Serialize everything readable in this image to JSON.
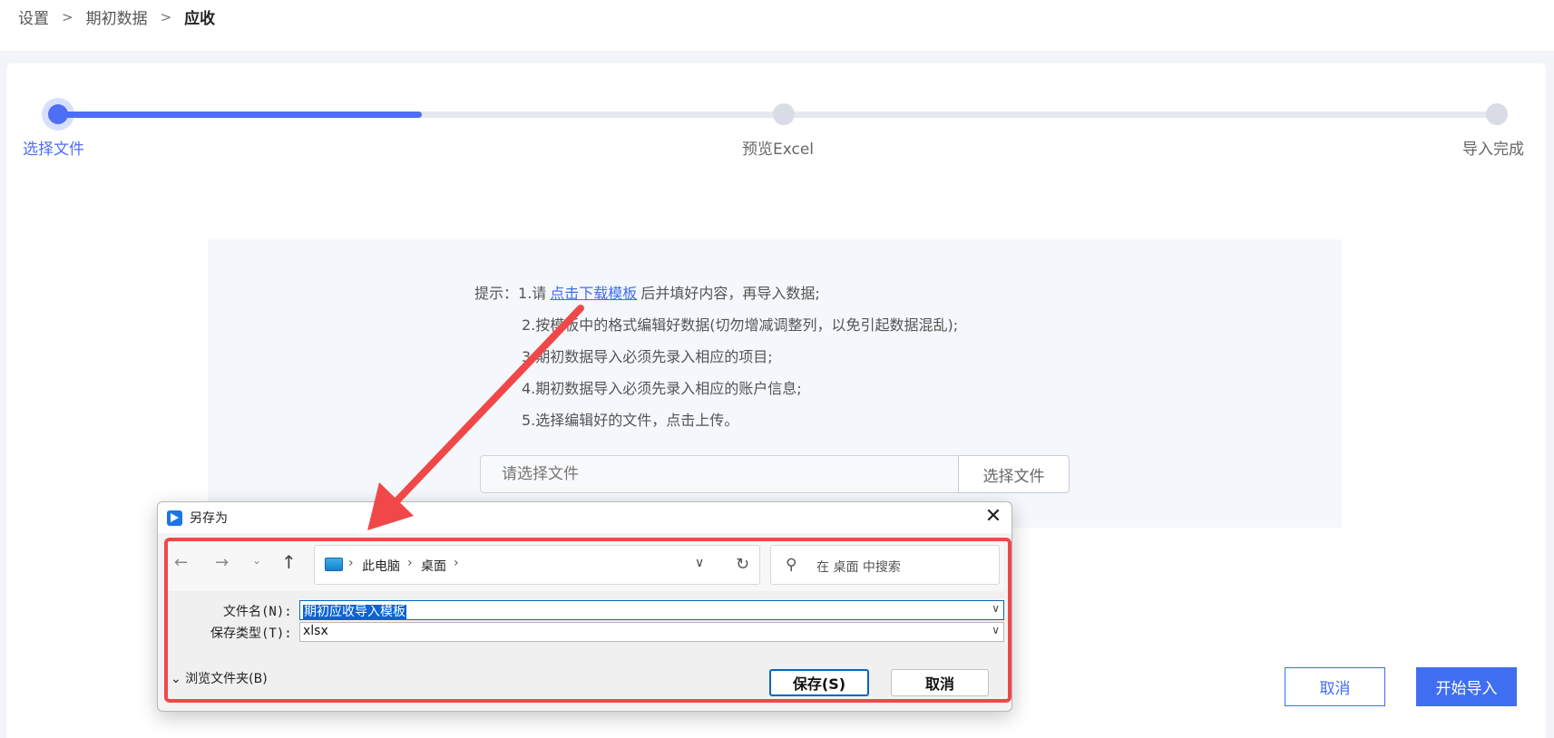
{
  "breadcrumb": {
    "item1": "设置",
    "item2": "期初数据",
    "current": "应收",
    "sep": ">"
  },
  "steps": [
    {
      "label": "选择文件"
    },
    {
      "label": "预览Excel"
    },
    {
      "label": "导入完成"
    }
  ],
  "tips": {
    "prefix": "提示：",
    "line1_before": "1.请",
    "download_link": "点击下载模板",
    "line1_after": "后并填好内容，再导入数据;",
    "line2": "2.按模板中的格式编辑好数据(切勿增减调整列，以免引起数据混乱);",
    "line3": "3.期初数据导入必须先录入相应的项目;",
    "line4": "4.期初数据导入必须先录入相应的账户信息;",
    "line5": "5.选择编辑好的文件，点击上传。"
  },
  "file_picker": {
    "placeholder": "请选择文件",
    "button": "选择文件"
  },
  "footer": {
    "cancel": "取消",
    "import": "开始导入"
  },
  "dialog": {
    "title": "另存为",
    "path": [
      "此电脑",
      "桌面"
    ],
    "search_placeholder": "在 桌面 中搜索",
    "filename_label": "文件名(N):",
    "filename_value": "期初应收导入模板",
    "type_label": "保存类型(T):",
    "type_value": "xlsx",
    "browse_folders": "浏览文件夹(B)",
    "save": "保存(S)",
    "cancel": "取消"
  },
  "colors": {
    "accent": "#3f6ef0",
    "annotation": "#f04848",
    "dialog_blue": "#0067c0"
  }
}
